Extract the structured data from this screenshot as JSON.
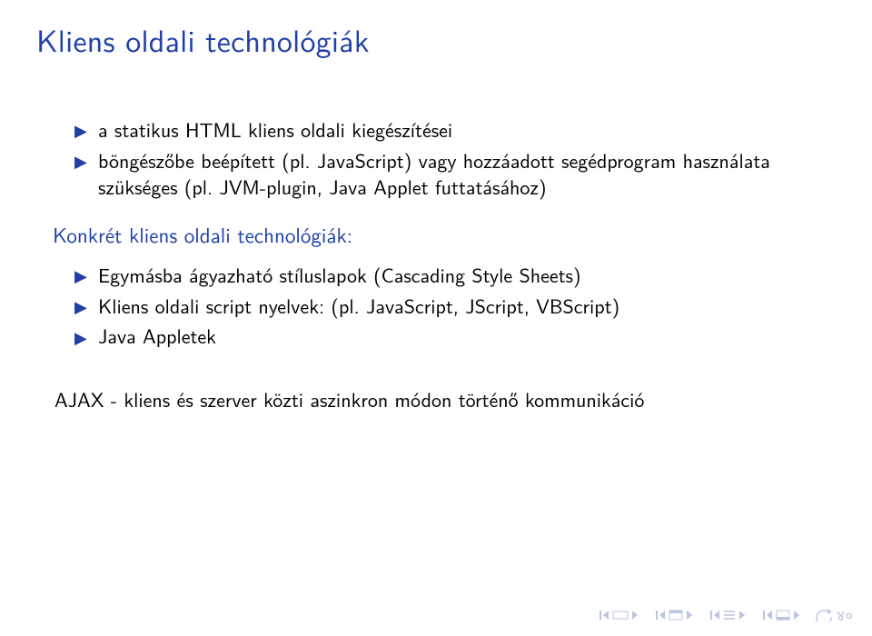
{
  "title": "Kliens oldali technológiák",
  "intro_items": [
    "a statikus HTML kliens oldali kiegészítései",
    "böngészőbe beépített (pl. JavaScript) vagy hozzáadott segédprogram használata szükséges (pl. JVM-plugin, Java Applet futtatásához)"
  ],
  "subheading": "Konkrét kliens oldali technológiák:",
  "tech_items": [
    "Egymásba ágyazható stíluslapok (Cascading Style Sheets)",
    "Kliens oldali script nyelvek: (pl. JavaScript, JScript, VBScript)",
    "Java Appletek"
  ],
  "footer_paragraph": "AJAX - kliens és szerver közti aszinkron módon történő kommunikáció",
  "nav": {
    "slide_first": "first-slide",
    "slide_prev": "previous-slide",
    "subsection_prev": "previous-subsection",
    "subsection_next": "next-subsection",
    "section_prev": "previous-section",
    "section_next": "next-section",
    "slide_next": "next-slide",
    "slide_last": "last-slide",
    "back": "back",
    "search": "search"
  }
}
